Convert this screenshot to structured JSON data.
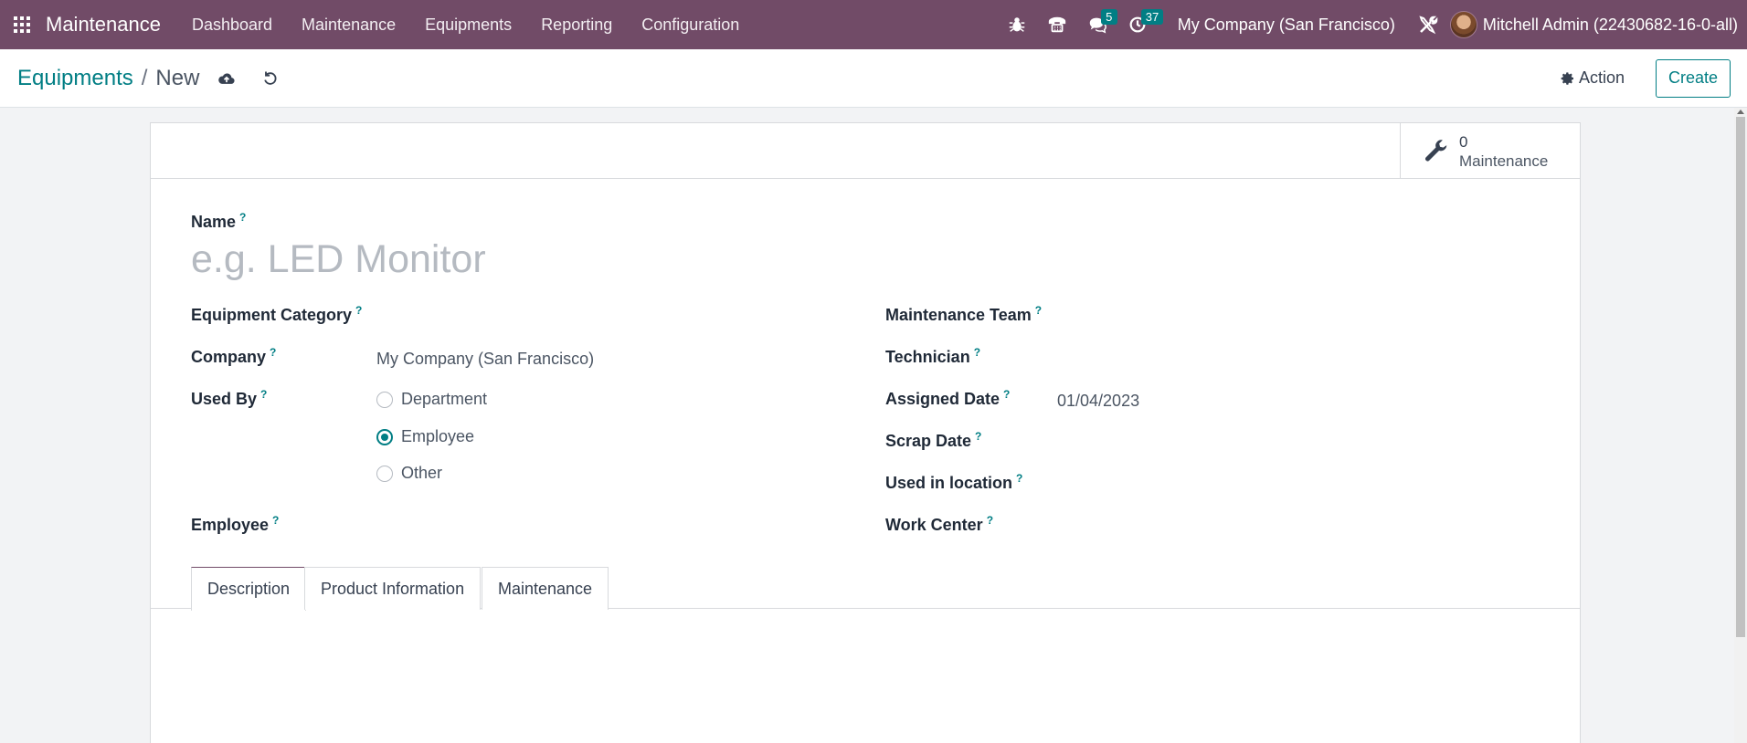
{
  "navbar": {
    "app_name": "Maintenance",
    "menu": [
      "Dashboard",
      "Maintenance",
      "Equipments",
      "Reporting",
      "Configuration"
    ],
    "messages_badge": "5",
    "activities_badge": "37",
    "company": "My Company (San Francisco)",
    "user": "Mitchell Admin (22430682-16-0-all)"
  },
  "control": {
    "breadcrumb_parent": "Equipments",
    "breadcrumb_separator": "/",
    "breadcrumb_current": "New",
    "action_label": "Action",
    "create_label": "Create"
  },
  "stat_button": {
    "value": "0",
    "label": "Maintenance"
  },
  "form": {
    "name_label": "Name",
    "name_placeholder": "e.g. LED Monitor",
    "help_mark": "?",
    "left": {
      "category_label": "Equipment Category",
      "company_label": "Company",
      "company_value": "My Company (San Francisco)",
      "used_by_label": "Used By",
      "used_by_options": [
        "Department",
        "Employee",
        "Other"
      ],
      "used_by_selected": "Employee",
      "employee_label": "Employee"
    },
    "right": {
      "team_label": "Maintenance Team",
      "technician_label": "Technician",
      "assigned_date_label": "Assigned Date",
      "assigned_date_value": "01/04/2023",
      "scrap_date_label": "Scrap Date",
      "location_label": "Used in location",
      "work_center_label": "Work Center"
    }
  },
  "tabs": [
    "Description",
    "Product Information",
    "Maintenance"
  ],
  "active_tab": "Description",
  "colors": {
    "brand": "#714b67",
    "accent": "#017e84"
  }
}
